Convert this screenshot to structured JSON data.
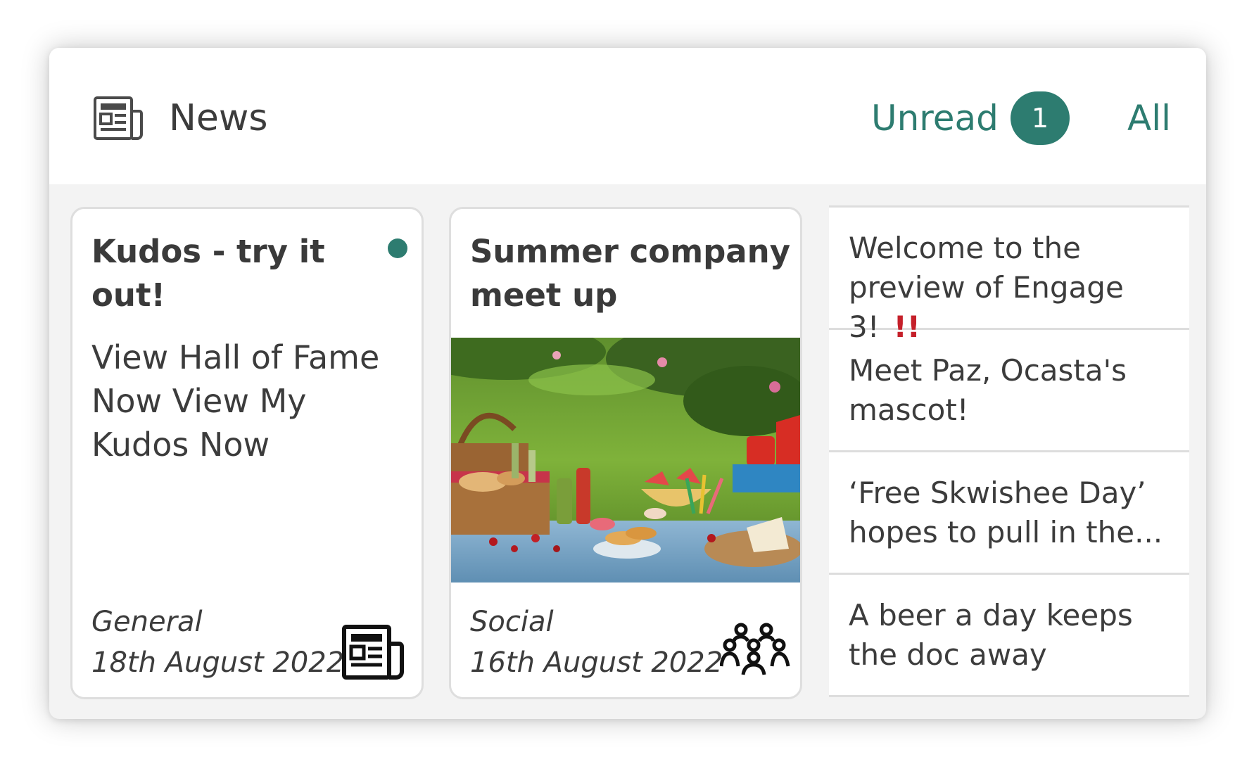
{
  "header": {
    "icon": "newspaper-icon",
    "title": "News",
    "tabs": {
      "unread_label": "Unread",
      "unread_count": "1",
      "all_label": "All"
    }
  },
  "cards": [
    {
      "title": "Kudos - try it out!",
      "unread": true,
      "body": "View Hall of Fame\nNow   View My\nKudos Now",
      "category": "General",
      "date": "18th August 2022",
      "type_icon": "newspaper-icon"
    },
    {
      "title": "Summer company meet up",
      "image": "picnic-image",
      "category": "Social",
      "date": "16th August 2022",
      "type_icon": "people-group-icon"
    }
  ],
  "list": [
    {
      "text": "Welcome to the preview of Engage 3!",
      "important_mark": "!!"
    },
    {
      "text": "Meet Paz, Ocasta's mascot!"
    },
    {
      "text": "‘Free Skwishee Day’ hopes to pull in the..."
    },
    {
      "text": "A beer a day keeps the doc away"
    }
  ],
  "colors": {
    "accent": "#2d7c70",
    "important": "#c5202a",
    "text": "#3c3c3c",
    "panel_background": "#f3f3f3"
  }
}
